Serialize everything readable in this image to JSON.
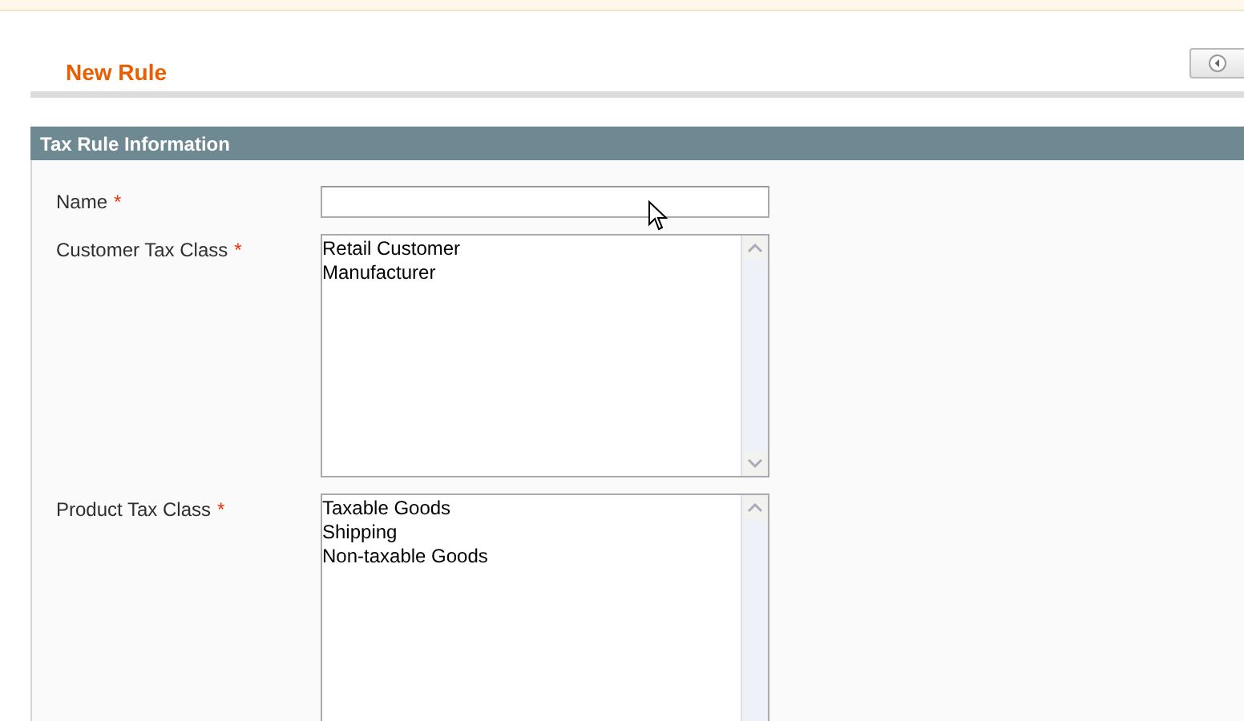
{
  "page": {
    "title": "New Rule"
  },
  "section": {
    "title": "Tax Rule Information"
  },
  "fields": [
    {
      "kind": "text",
      "label": "Name",
      "required_mark": "*"
    },
    {
      "kind": "multiselect",
      "label": "Customer Tax Class",
      "required_mark": "*",
      "options": [
        "Retail Customer",
        "Manufacturer"
      ]
    },
    {
      "kind": "multiselect",
      "label": "Product Tax Class",
      "required_mark": "*",
      "options": [
        "Taxable Goods",
        "Shipping",
        "Non-taxable Goods"
      ]
    }
  ]
}
